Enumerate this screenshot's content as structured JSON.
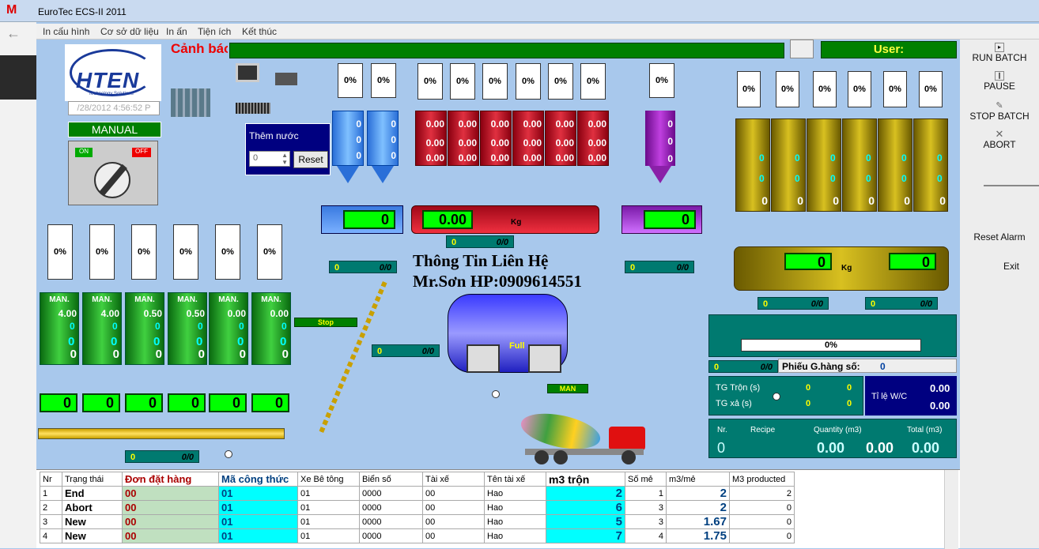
{
  "window": {
    "title": "EuroTec ECS-II 2011",
    "gmail": "M"
  },
  "menu": [
    "In cấu hình",
    "Cơ sở dữ liệu",
    "In ấn",
    "Tiện ích",
    "Kết thúc"
  ],
  "header": {
    "warning": "Cảnh báo",
    "user_label": "User:"
  },
  "logo": {
    "text": "HTEN",
    "sub": "Technology Solutions",
    "datetime": "/28/2012 4:56:52 P"
  },
  "mode": {
    "label": "MANUAL",
    "on": "ON",
    "off": "OFF"
  },
  "water": {
    "title": "Thêm nước",
    "value": "0",
    "reset": "Reset"
  },
  "side": {
    "run": "RUN BATCH",
    "pause": "PAUSE",
    "stop": "STOP BATCH",
    "abort": "ABORT",
    "reset_alarm": "Reset Alarm",
    "exit": "Exit"
  },
  "pct": "0%",
  "zero": "0",
  "zero2": "0.00",
  "blue_silos": {
    "vals": [
      "0",
      "0",
      "0"
    ]
  },
  "red_silos": {
    "vals": [
      "0.00",
      "0.00",
      "0.00"
    ]
  },
  "purple_silo": {
    "vals": [
      "0",
      "0",
      "0"
    ]
  },
  "gold_silos": {
    "vals": [
      "0",
      "0",
      "0"
    ]
  },
  "green_silos": {
    "mode": "MAN.",
    "top": [
      "4.00",
      "4.00",
      "0.50",
      "0.50",
      "0.00",
      "0.00"
    ]
  },
  "scale": {
    "kg": "Kg",
    "center": "0.00",
    "left": "0",
    "right": "0",
    "gold_left": "0",
    "gold_right": "0"
  },
  "teal": {
    "l": "0",
    "r": "0/0"
  },
  "stop_label": "Stop",
  "contact": {
    "line1": "Thông Tin Liên Hệ",
    "line2": "Mr.Sơn HP:0909614551"
  },
  "mixer": {
    "full": "Full",
    "man": "MAN"
  },
  "progress": {
    "pct": "0%",
    "fraction": 0
  },
  "batch": {
    "label": "Phiếu G.hàng số:",
    "value": "0"
  },
  "times": {
    "mix": "TG Trộn (s)",
    "discharge": "TG xả (s)",
    "ratio": "Tỉ lệ W/C",
    "v1": "0",
    "v2": "0",
    "r1": "0.00",
    "r2": "0.00"
  },
  "summary": {
    "nr": "Nr.",
    "recipe": "Recipe",
    "quantity": "Quantity (m3)",
    "total": "Total (m3)",
    "nr_v": "0",
    "q": "0.00",
    "r": "0.00",
    "t": "0.00"
  },
  "table": {
    "headers": [
      "Nr",
      "Trạng thái",
      "Đơn đặt hàng",
      "Mã công thức",
      "Xe Bê tông",
      "Biển số",
      "Tài xế",
      "Tên tài xế",
      "m3 trộn",
      "Số mẻ",
      "m3/mẻ",
      "M3 producted"
    ],
    "rows": [
      [
        "1",
        "End",
        "00",
        "01",
        "01",
        "0000",
        "00",
        "Hao",
        "2",
        "1",
        "2",
        "2"
      ],
      [
        "2",
        "Abort",
        "00",
        "01",
        "01",
        "0000",
        "00",
        "Hao",
        "6",
        "3",
        "2",
        "0"
      ],
      [
        "3",
        "New",
        "00",
        "01",
        "01",
        "0000",
        "00",
        "Hao",
        "5",
        "3",
        "1.67",
        "0"
      ],
      [
        "4",
        "New",
        "00",
        "01",
        "01",
        "0000",
        "00",
        "Hao",
        "7",
        "4",
        "1.75",
        "0"
      ]
    ]
  }
}
